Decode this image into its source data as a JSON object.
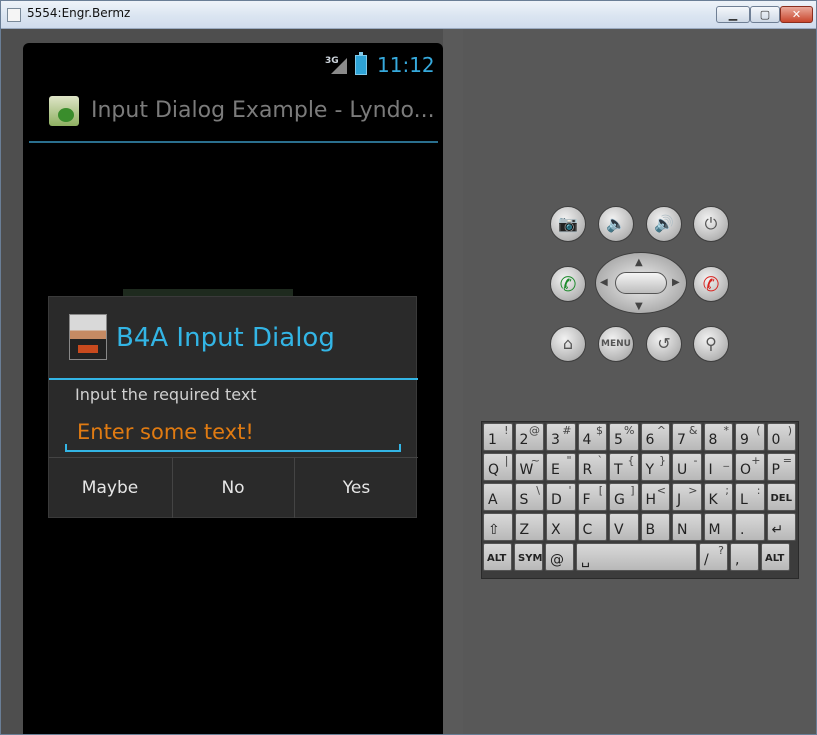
{
  "window": {
    "title": "5554:Engr.Bermz",
    "min_icon": "minimize-icon",
    "max_icon": "maximize-icon",
    "close_icon": "close-icon"
  },
  "status_bar": {
    "network": "3G",
    "time": "11:12",
    "battery_icon": "battery-charging-icon"
  },
  "action_bar": {
    "title": "Input Dialog Example - Lyndo..."
  },
  "dialog": {
    "title": "B4A Input Dialog",
    "label": "Input the required text",
    "input_placeholder": "Enter some text!",
    "buttons": [
      "Maybe",
      "No",
      "Yes"
    ]
  },
  "controls": {
    "menu_label": "MENU"
  },
  "keyboard": {
    "row1": [
      [
        "1",
        "!"
      ],
      [
        "2",
        "@"
      ],
      [
        "3",
        "#"
      ],
      [
        "4",
        "$"
      ],
      [
        "5",
        "%"
      ],
      [
        "6",
        "^"
      ],
      [
        "7",
        "&"
      ],
      [
        "8",
        "*"
      ],
      [
        "9",
        "("
      ],
      [
        "0",
        ")"
      ]
    ],
    "row2": [
      [
        "Q",
        "|"
      ],
      [
        "W",
        "~"
      ],
      [
        "E",
        "\""
      ],
      [
        "R",
        "`"
      ],
      [
        "T",
        "{"
      ],
      [
        "Y",
        "}"
      ],
      [
        "U",
        "-"
      ],
      [
        "I",
        "_"
      ],
      [
        "O",
        "+"
      ],
      [
        "P",
        "="
      ]
    ],
    "row3": [
      [
        "A",
        ""
      ],
      [
        "S",
        "\\"
      ],
      [
        "D",
        "'"
      ],
      [
        "F",
        "["
      ],
      [
        "G",
        "]"
      ],
      [
        "H",
        "<"
      ],
      [
        "J",
        ">"
      ],
      [
        "K",
        ";"
      ],
      [
        "L",
        ":"
      ],
      [
        "DEL",
        ""
      ]
    ],
    "row4": [
      [
        "⇧",
        ""
      ],
      [
        "Z",
        ""
      ],
      [
        "X",
        ""
      ],
      [
        "C",
        ""
      ],
      [
        "V",
        ""
      ],
      [
        "B",
        ""
      ],
      [
        "N",
        ""
      ],
      [
        "M",
        ""
      ],
      [
        ".",
        ""
      ],
      [
        "↵",
        ""
      ]
    ],
    "row5": [
      [
        "ALT",
        ""
      ],
      [
        "SYM",
        ""
      ],
      [
        "@",
        ""
      ],
      [
        "␣",
        ""
      ],
      [
        "/",
        "?"
      ],
      [
        ",",
        ""
      ],
      [
        "ALT",
        ""
      ]
    ]
  },
  "colors": {
    "accent": "#33b5e5",
    "placeholder": "#e07b12"
  }
}
